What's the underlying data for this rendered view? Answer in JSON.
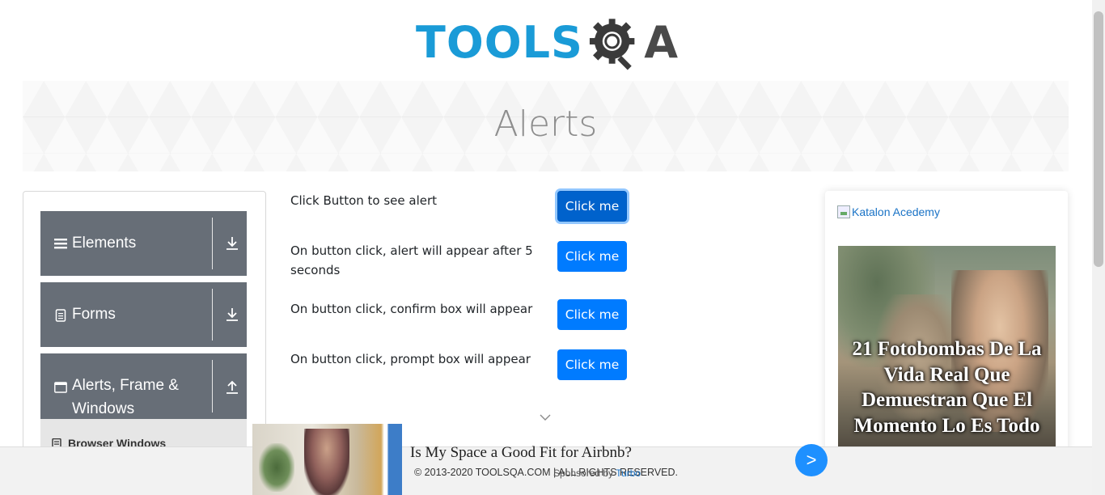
{
  "logo": {
    "text_left": "TOOLS",
    "text_right": "A",
    "alt": "TOOLSQA"
  },
  "page_title": "Alerts",
  "sidebar": {
    "groups": [
      {
        "label": "Elements",
        "icon": "hamburger-icon",
        "toggle": "download-arrow-icon"
      },
      {
        "label": "Forms",
        "icon": "document-icon",
        "toggle": "download-arrow-icon"
      },
      {
        "label": "Alerts, Frame & Windows",
        "icon": "window-icon",
        "toggle": "upload-arrow-icon"
      }
    ],
    "submenu_item": "Browser Windows"
  },
  "rows": [
    {
      "text": "Click Button to see alert",
      "button": "Click me"
    },
    {
      "text": "On button click, alert will appear after 5 seconds",
      "button": "Click me"
    },
    {
      "text": "On button click, confirm box will appear",
      "button": "Click me"
    },
    {
      "text": "On button click, prompt box will appear",
      "button": "Click me"
    }
  ],
  "right_ad": {
    "link_text": "Katalon Acedemy",
    "headline": "21 Fotobombas De La Vida Real Que Demuestran Que El Momento Lo Es Todo"
  },
  "footer": {
    "copyright": "© 2013-2020 TOOLSQA.COM | ALL RIGHTS RESERVED."
  },
  "sticky_ad": {
    "title": "Is My Space a Good Fit for Airbnb?",
    "sponsor_prefix": "Sponsored by",
    "sponsor_name": "Turbo",
    "next": ">"
  },
  "colors": {
    "primary_button": "#007bff",
    "sidebar_group": "#676e77",
    "logo_blue": "#1a9bd7",
    "logo_dark": "#4a4a4a"
  }
}
